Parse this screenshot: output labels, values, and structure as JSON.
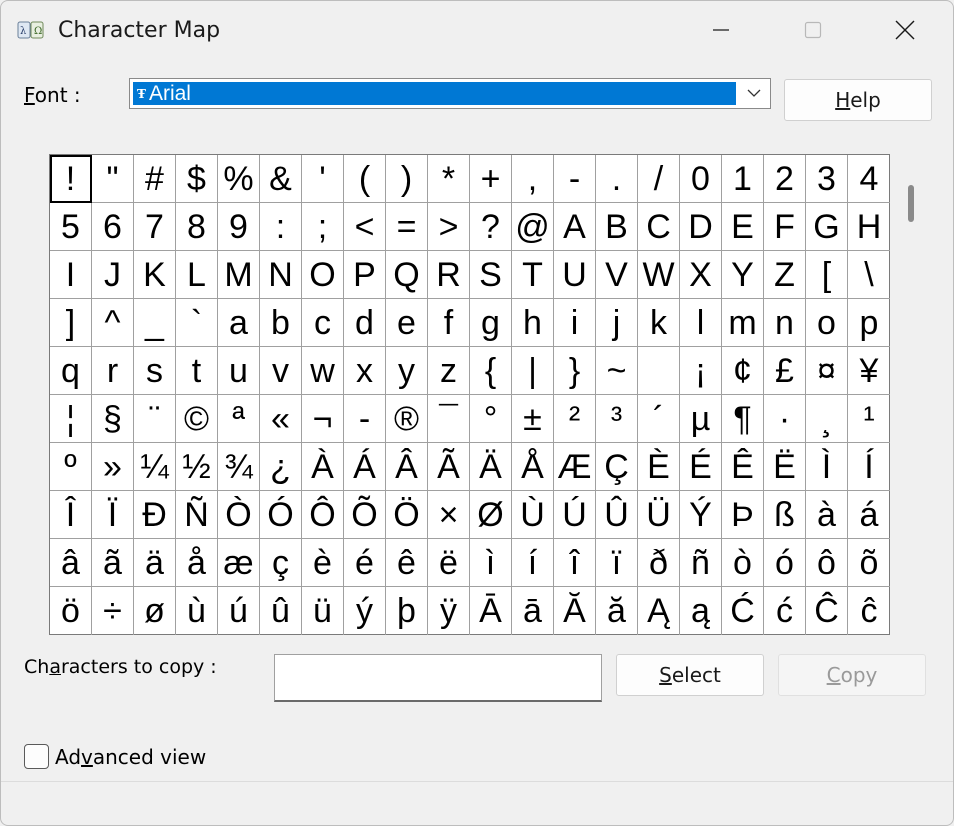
{
  "window": {
    "title": "Character Map",
    "icon": "charmap-app-icon"
  },
  "font_row": {
    "label_prefix": "F",
    "label_rest": "ont :",
    "selected_font": "Arial",
    "font_icon": "truetype-icon"
  },
  "buttons": {
    "help_prefix": "H",
    "help_rest": "elp",
    "select_prefix": "S",
    "select_rest": "elect",
    "copy_prefix": "C",
    "copy_rest": "opy"
  },
  "copy_row": {
    "label_a": "Ch",
    "label_u": "a",
    "label_b": "racters to copy :",
    "value": ""
  },
  "advanced": {
    "label_a": "Ad",
    "label_u": "v",
    "label_b": "anced view",
    "checked": false
  },
  "grid": {
    "columns": 20,
    "selected_index": 0,
    "chars": [
      "!",
      "\"",
      "#",
      "$",
      "%",
      "&",
      "'",
      "(",
      ")",
      "*",
      "+",
      ",",
      "-",
      ".",
      "/",
      "0",
      "1",
      "2",
      "3",
      "4",
      "5",
      "6",
      "7",
      "8",
      "9",
      ":",
      ";",
      "<",
      "=",
      ">",
      "?",
      "@",
      "A",
      "B",
      "C",
      "D",
      "E",
      "F",
      "G",
      "H",
      "I",
      "J",
      "K",
      "L",
      "M",
      "N",
      "O",
      "P",
      "Q",
      "R",
      "S",
      "T",
      "U",
      "V",
      "W",
      "X",
      "Y",
      "Z",
      "[",
      "\\",
      "]",
      "^",
      "_",
      "`",
      "a",
      "b",
      "c",
      "d",
      "e",
      "f",
      "g",
      "h",
      "i",
      "j",
      "k",
      "l",
      "m",
      "n",
      "o",
      "p",
      "q",
      "r",
      "s",
      "t",
      "u",
      "v",
      "w",
      "x",
      "y",
      "z",
      "{",
      "|",
      "}",
      "~",
      " ",
      "¡",
      "¢",
      "£",
      "¤",
      "¥",
      "¦",
      "§",
      "¨",
      "©",
      "ª",
      "«",
      "¬",
      "-",
      "®",
      "¯",
      "°",
      "±",
      "²",
      "³",
      "´",
      "µ",
      "¶",
      "·",
      "¸",
      "¹",
      "º",
      "»",
      "¼",
      "½",
      "¾",
      "¿",
      "À",
      "Á",
      "Â",
      "Ã",
      "Ä",
      "Å",
      "Æ",
      "Ç",
      "È",
      "É",
      "Ê",
      "Ë",
      "Ì",
      "Í",
      "Î",
      "Ï",
      "Ð",
      "Ñ",
      "Ò",
      "Ó",
      "Ô",
      "Õ",
      "Ö",
      "×",
      "Ø",
      "Ù",
      "Ú",
      "Û",
      "Ü",
      "Ý",
      "Þ",
      "ß",
      "à",
      "á",
      "â",
      "ã",
      "ä",
      "å",
      "æ",
      "ç",
      "è",
      "é",
      "ê",
      "ë",
      "ì",
      "í",
      "î",
      "ï",
      "ð",
      "ñ",
      "ò",
      "ó",
      "ô",
      "õ",
      "ö",
      "÷",
      "ø",
      "ù",
      "ú",
      "û",
      "ü",
      "ý",
      "þ",
      "ÿ",
      "Ā",
      "ā",
      "Ă",
      "ă",
      "Ą",
      "ą",
      "Ć",
      "ć",
      "Ĉ",
      "ĉ"
    ]
  }
}
